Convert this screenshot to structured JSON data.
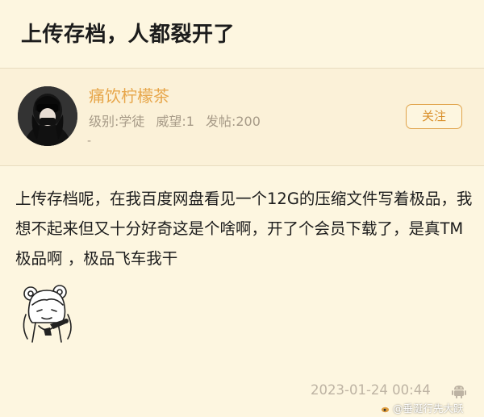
{
  "post": {
    "title": "上传存档，人都裂开了",
    "body": "上传存档呢，在我百度网盘看见一个12G的压缩文件写着极品，我想不起来但又十分好奇这是个啥啊，开了个会员下载了，是真TM极品啊 ，极品飞车我干",
    "timestamp": "2023-01-24 00:44"
  },
  "author": {
    "name": "痛饮柠檬茶",
    "level": "级别:学徒",
    "prestige": "威望:1",
    "posts": "发帖:200",
    "extra": "-",
    "follow_label": "关注"
  },
  "watermark": {
    "text": "@垂涎行先大跃"
  },
  "colors": {
    "background": "#fdf6e0",
    "accent": "#e7a64a",
    "muted_text": "#a79b88"
  },
  "icons": {
    "device": "android-icon",
    "emoji": "anime-girl-sticker",
    "avatar": "masked-girl-avatar"
  }
}
